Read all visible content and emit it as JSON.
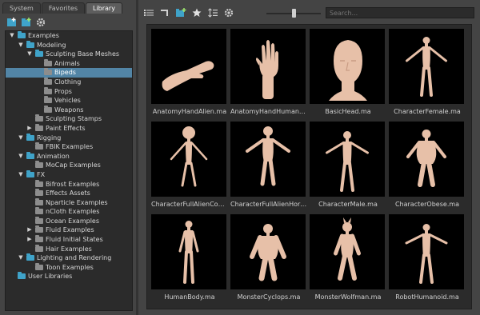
{
  "tabs": [
    "System",
    "Favorites",
    "Library"
  ],
  "active_tab": 2,
  "left_toolbar": [
    "add-folder-icon",
    "add-item-icon",
    "gear-icon"
  ],
  "tree": [
    {
      "label": "Examples",
      "depth": 0,
      "expanded": true,
      "icon": "open"
    },
    {
      "label": "Modeling",
      "depth": 1,
      "expanded": true,
      "icon": "open"
    },
    {
      "label": "Sculpting Base Meshes",
      "depth": 2,
      "expanded": true,
      "icon": "open"
    },
    {
      "label": "Animals",
      "depth": 3,
      "icon": "closed"
    },
    {
      "label": "Bipeds",
      "depth": 3,
      "icon": "closed",
      "selected": true
    },
    {
      "label": "Clothing",
      "depth": 3,
      "icon": "closed"
    },
    {
      "label": "Props",
      "depth": 3,
      "icon": "closed"
    },
    {
      "label": "Vehicles",
      "depth": 3,
      "icon": "closed"
    },
    {
      "label": "Weapons",
      "depth": 3,
      "icon": "closed"
    },
    {
      "label": "Sculpting Stamps",
      "depth": 2,
      "icon": "closed"
    },
    {
      "label": "Paint Effects",
      "depth": 2,
      "collapsed": true,
      "icon": "closed"
    },
    {
      "label": "Rigging",
      "depth": 1,
      "expanded": true,
      "icon": "open"
    },
    {
      "label": "FBIK Examples",
      "depth": 2,
      "icon": "closed"
    },
    {
      "label": "Animation",
      "depth": 1,
      "expanded": true,
      "icon": "open"
    },
    {
      "label": "MoCap Examples",
      "depth": 2,
      "icon": "closed"
    },
    {
      "label": "FX",
      "depth": 1,
      "expanded": true,
      "icon": "open"
    },
    {
      "label": "Bifrost Examples",
      "depth": 2,
      "icon": "closed"
    },
    {
      "label": "Effects Assets",
      "depth": 2,
      "icon": "closed"
    },
    {
      "label": "Nparticle Examples",
      "depth": 2,
      "icon": "closed"
    },
    {
      "label": "nCloth Examples",
      "depth": 2,
      "icon": "closed"
    },
    {
      "label": "Ocean Examples",
      "depth": 2,
      "icon": "closed"
    },
    {
      "label": "Fluid Examples",
      "depth": 2,
      "collapsed": true,
      "icon": "closed"
    },
    {
      "label": "Fluid Initial States",
      "depth": 2,
      "collapsed": true,
      "icon": "closed"
    },
    {
      "label": "Hair Examples",
      "depth": 2,
      "icon": "closed"
    },
    {
      "label": "Lighting and Rendering",
      "depth": 1,
      "expanded": true,
      "icon": "open"
    },
    {
      "label": "Toon Examples",
      "depth": 2,
      "icon": "closed"
    },
    {
      "label": "User Libraries",
      "depth": 0,
      "icon": "open"
    }
  ],
  "right_toolbar": [
    "list-view-icon",
    "back-arrow-icon",
    "new-folder-icon",
    "favorite-star-icon",
    "sort-icon",
    "gear-icon"
  ],
  "thumbnail_size_level": 0.5,
  "search": {
    "placeholder": "Search..."
  },
  "items": [
    {
      "label": "AnatomyHandAlien.ma",
      "kind": "hand-alien"
    },
    {
      "label": "AnatomyHandHumanM...",
      "kind": "hand-human"
    },
    {
      "label": "BasicHead.ma",
      "kind": "head"
    },
    {
      "label": "CharacterFemale.ma",
      "kind": "female"
    },
    {
      "label": "CharacterFullAlienCons...",
      "kind": "alien"
    },
    {
      "label": "CharacterFullAlienHorr...",
      "kind": "alien-horror"
    },
    {
      "label": "CharacterMale.ma",
      "kind": "male"
    },
    {
      "label": "CharacterObese.ma",
      "kind": "obese"
    },
    {
      "label": "HumanBody.ma",
      "kind": "human"
    },
    {
      "label": "MonsterCyclops.ma",
      "kind": "cyclops"
    },
    {
      "label": "MonsterWolfman.ma",
      "kind": "wolfman"
    },
    {
      "label": "RobotHumanoid.ma",
      "kind": "robot"
    }
  ]
}
